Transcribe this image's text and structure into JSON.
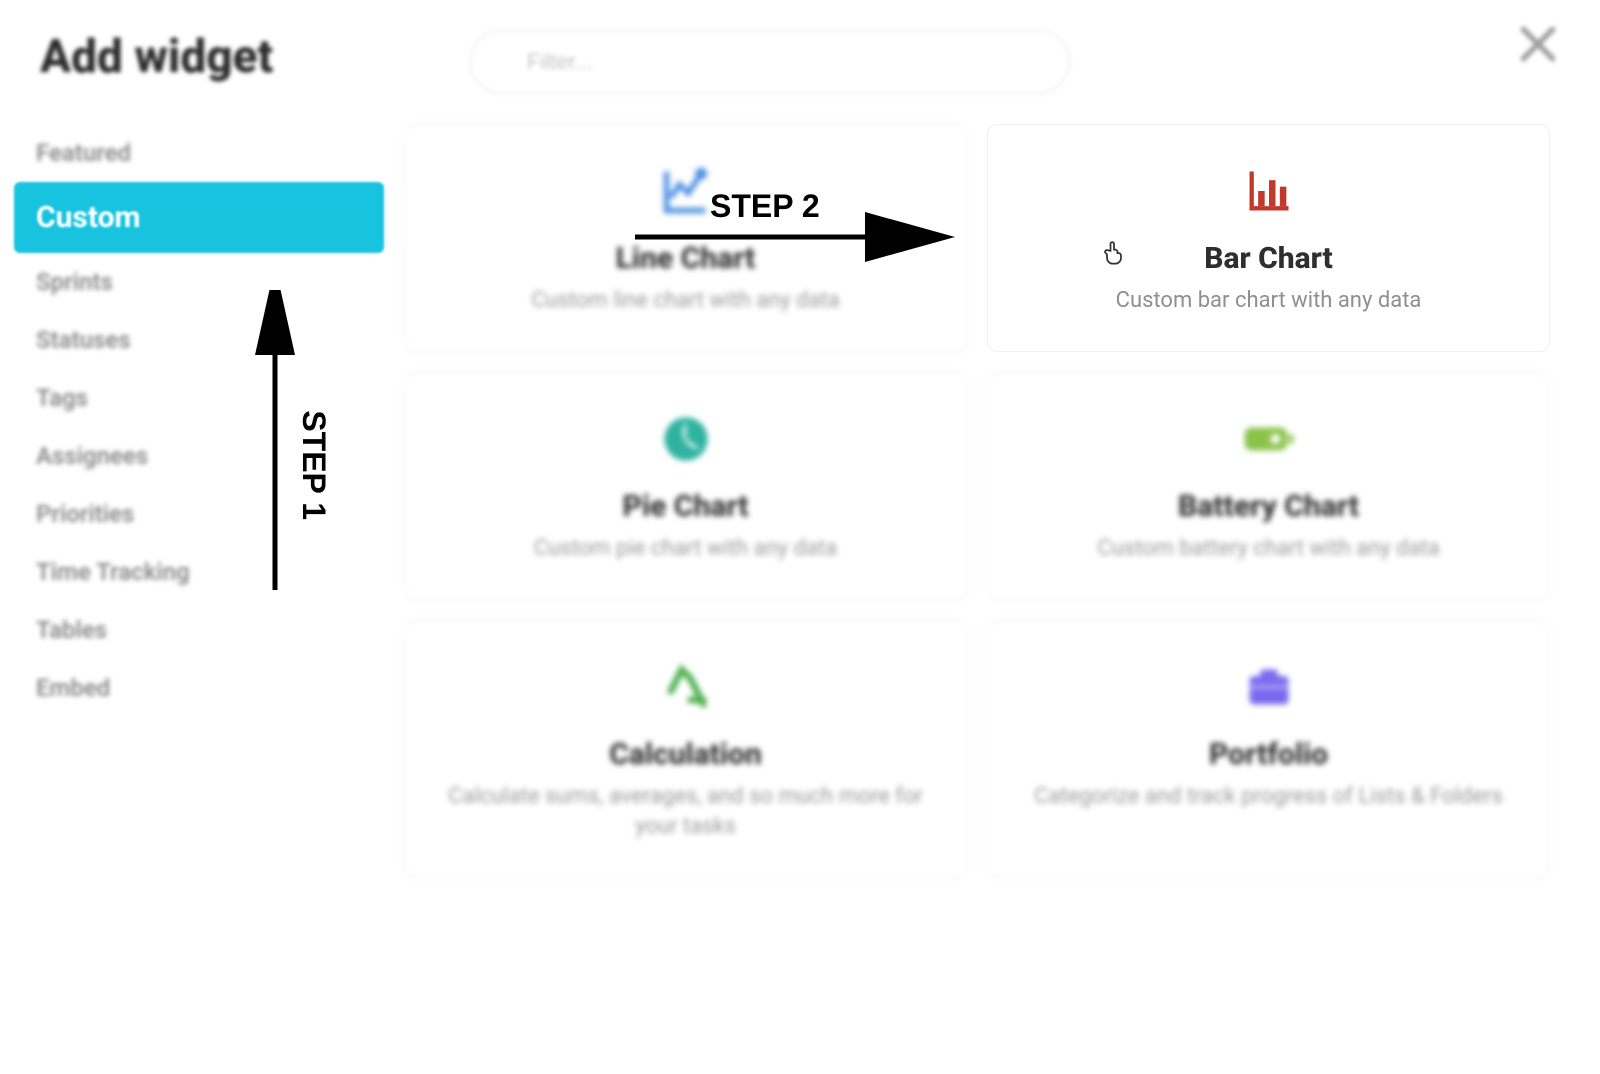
{
  "header": {
    "title": "Add widget",
    "search_placeholder": "Filter..."
  },
  "sidebar": {
    "items": [
      {
        "label": "Featured",
        "active": false
      },
      {
        "label": "Custom",
        "active": true
      },
      {
        "label": "Sprints",
        "active": false
      },
      {
        "label": "Statuses",
        "active": false
      },
      {
        "label": "Tags",
        "active": false
      },
      {
        "label": "Assignees",
        "active": false
      },
      {
        "label": "Priorities",
        "active": false
      },
      {
        "label": "Time Tracking",
        "active": false
      },
      {
        "label": "Tables",
        "active": false
      },
      {
        "label": "Embed",
        "active": false
      }
    ]
  },
  "widgets": [
    {
      "icon": "line-chart",
      "title": "Line Chart",
      "desc": "Custom line chart with any data",
      "focused": false,
      "color": "#4a90e2"
    },
    {
      "icon": "bar-chart",
      "title": "Bar Chart",
      "desc": "Custom bar chart with any data",
      "focused": true,
      "color": "#c0392b"
    },
    {
      "icon": "pie-chart",
      "title": "Pie Chart",
      "desc": "Custom pie chart with any data",
      "focused": false,
      "color": "#2fb3a0"
    },
    {
      "icon": "battery",
      "title": "Battery Chart",
      "desc": "Custom battery chart with any data",
      "focused": false,
      "color": "#8bc34a"
    },
    {
      "icon": "calc",
      "title": "Calculation",
      "desc": "Calculate sums, averages, and so much more for your tasks",
      "focused": false,
      "color": "#4caf50"
    },
    {
      "icon": "portfolio",
      "title": "Portfolio",
      "desc": "Categorize and track progress of Lists & Folders",
      "focused": false,
      "color": "#7b68ee"
    }
  ],
  "annotations": {
    "step1": "STEP 1",
    "step2": "STEP 2"
  }
}
